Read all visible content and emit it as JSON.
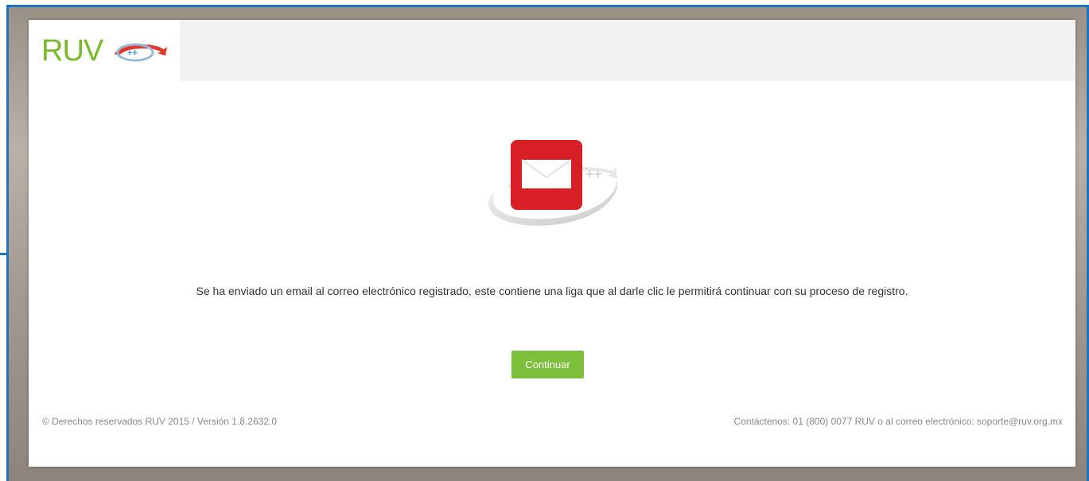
{
  "header": {
    "logo_text": "RUV",
    "logo_badge": "++"
  },
  "main": {
    "illustration_icon": "email-envelope-icon",
    "illustration_badge": "++",
    "message": "Se ha enviado un email al correo electrónico registrado, este contiene una liga que al darle clic le permitirá continuar con su proceso de registro.",
    "continue_label": "Continuar"
  },
  "footer": {
    "copyright": "© Derechos reservados RUV 2015 / Versión 1.8.2632.0",
    "contact": "Contáctenos: 01 (800) 0077 RUV o al correo electrónico: soporte@ruv.org.mx"
  },
  "colors": {
    "brand_green": "#7ab929",
    "button_green": "#7bbf3a",
    "mail_red": "#d81f26",
    "frame_blue": "#1e73be"
  }
}
